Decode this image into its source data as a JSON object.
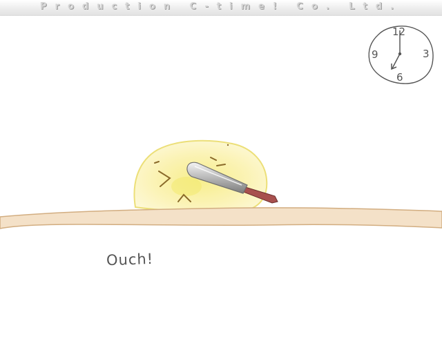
{
  "banner": {
    "company": "Production C-time! Co. Ltd."
  },
  "clock": {
    "numerals": {
      "top": "12",
      "right": "3",
      "bottom": "6",
      "left": "9"
    }
  },
  "scene": {
    "caption": "Ouch!",
    "character": "butter-blob",
    "prop": "butter-knife",
    "surface": "bread-crust"
  },
  "colors": {
    "butter": "#faf0a8",
    "butter_outline": "#eadc6a",
    "crust_fill": "#f4e1c8",
    "crust_outline": "#d2ad80",
    "knife_handle": "#a8504e",
    "knife_blade": "#c8c8c8"
  }
}
